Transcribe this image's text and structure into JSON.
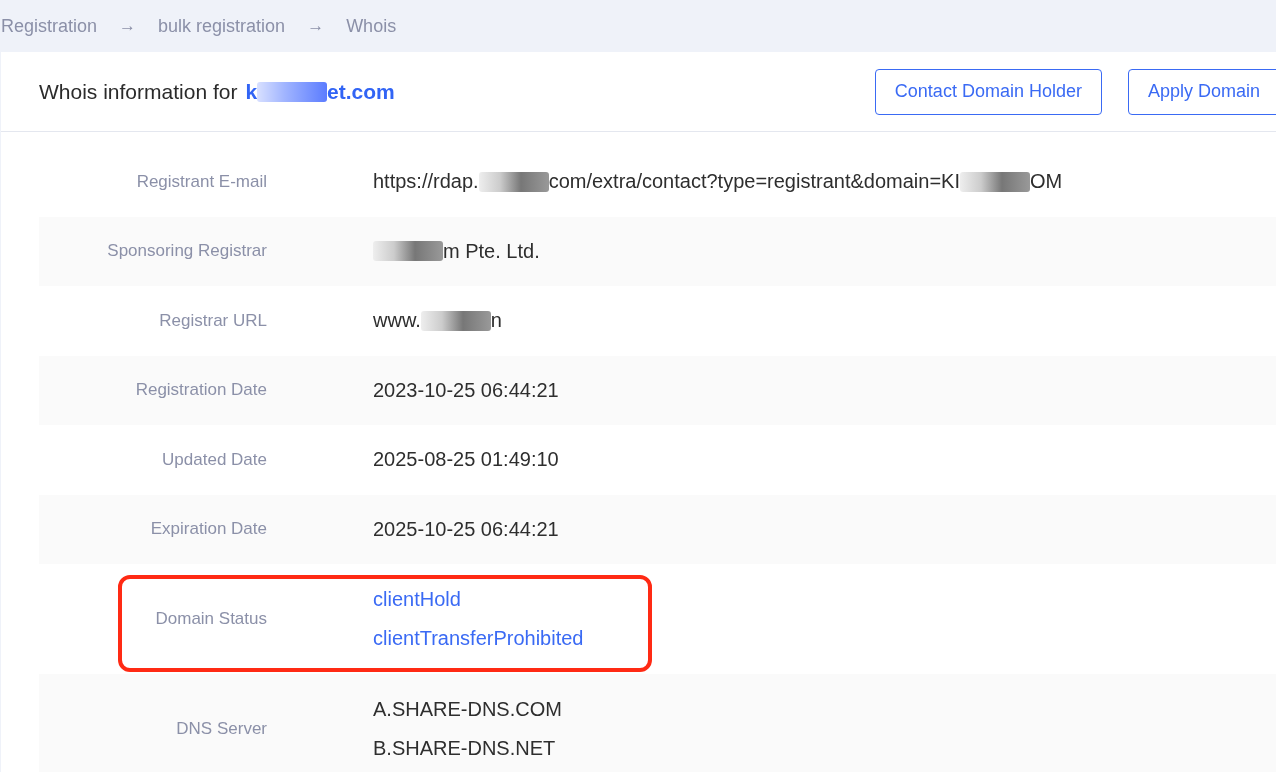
{
  "breadcrumb": [
    {
      "label": "Registration"
    },
    {
      "label": "bulk registration"
    },
    {
      "label": "Whois"
    }
  ],
  "breadcrumb_separator": "→",
  "header": {
    "title": "Whois information for",
    "domain": [
      {
        "kind": "text",
        "text": "k"
      },
      {
        "kind": "redaction"
      },
      {
        "kind": "text",
        "text": "et.com"
      }
    ]
  },
  "buttons": [
    {
      "label": "Contact Domain Holder"
    },
    {
      "label": "Apply Domain"
    }
  ],
  "rows": [
    {
      "label": "Registrant E-mail",
      "highlighted": false,
      "values": [
        [
          {
            "kind": "text",
            "text": "https://rdap."
          },
          {
            "kind": "redaction"
          },
          {
            "kind": "text",
            "text": "com/extra/contact?type=registrant&domain=KI"
          },
          {
            "kind": "redaction"
          },
          {
            "kind": "text",
            "text": "OM"
          }
        ]
      ]
    },
    {
      "label": "Sponsoring Registrar",
      "highlighted": false,
      "values": [
        [
          {
            "kind": "redaction"
          },
          {
            "kind": "text",
            "text": "m Pte. Ltd."
          }
        ]
      ]
    },
    {
      "label": "Registrar URL",
      "highlighted": false,
      "values": [
        [
          {
            "kind": "text",
            "text": "www."
          },
          {
            "kind": "redaction"
          },
          {
            "kind": "text",
            "text": "n"
          }
        ]
      ]
    },
    {
      "label": "Registration Date",
      "highlighted": false,
      "values": [
        [
          {
            "kind": "text",
            "text": "2023-10-25 06:44:21"
          }
        ]
      ]
    },
    {
      "label": "Updated Date",
      "highlighted": false,
      "values": [
        [
          {
            "kind": "text",
            "text": "2025-08-25 01:49:10"
          }
        ]
      ]
    },
    {
      "label": "Expiration Date",
      "highlighted": false,
      "values": [
        [
          {
            "kind": "text",
            "text": "2025-10-25 06:44:21"
          }
        ]
      ]
    },
    {
      "label": "Domain Status",
      "highlighted": true,
      "kind": "link",
      "values": [
        [
          {
            "kind": "text",
            "text": "clientHold"
          }
        ],
        [
          {
            "kind": "text",
            "text": "clientTransferProhibited"
          }
        ]
      ]
    },
    {
      "label": "DNS Server",
      "highlighted": false,
      "values": [
        [
          {
            "kind": "text",
            "text": "A.SHARE-DNS.COM"
          }
        ],
        [
          {
            "kind": "text",
            "text": "B.SHARE-DNS.NET"
          }
        ]
      ]
    }
  ]
}
